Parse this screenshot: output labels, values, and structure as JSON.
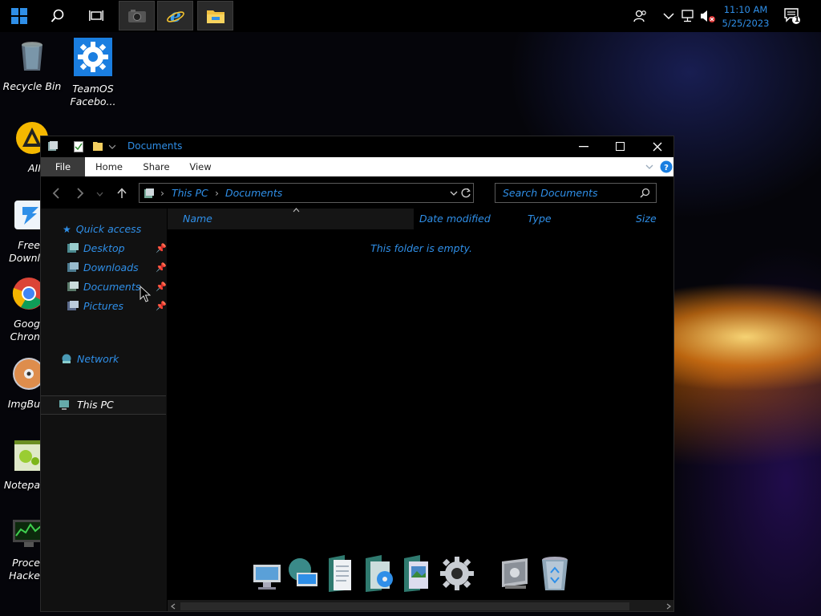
{
  "taskbar": {
    "clock_time": "11:10 AM",
    "clock_date": "5/25/2023",
    "notification_count": "1",
    "start_icon": "windows-logo-icon",
    "search_icon": "search-icon",
    "task_view_icon": "task-view-icon",
    "pinned_apps": [
      "camera-app-icon",
      "internet-explorer-icon",
      "file-explorer-icon"
    ],
    "tray_icons": [
      "people-icon",
      "chevron-up-icon",
      "network-icon",
      "volume-muted-icon",
      "action-center-icon"
    ]
  },
  "desktop": {
    "icons": [
      {
        "label": "Recycle Bin",
        "icon": "recycle-bin-icon"
      },
      {
        "label": "TeamOS Facebo...",
        "icon": "gear-icon"
      },
      {
        "label": "AIM",
        "icon": "aimp-icon"
      },
      {
        "label": "Free Downl",
        "icon": "free-download-manager-icon"
      },
      {
        "label": "Goog Chron",
        "icon": "chrome-icon"
      },
      {
        "label": "ImgBu",
        "icon": "imgburn-icon"
      },
      {
        "label": "Notepa",
        "icon": "notepad-icon"
      },
      {
        "label": "Proce Hacke",
        "icon": "process-hacker-icon"
      }
    ]
  },
  "window": {
    "title": "Documents",
    "ribbon_tabs": [
      "File",
      "Home",
      "Share",
      "View"
    ],
    "address": {
      "crumbs": [
        "This PC",
        "Documents"
      ]
    },
    "search_placeholder": "Search Documents",
    "nav": {
      "quick_access": "Quick access",
      "quick_items": [
        "Desktop",
        "Downloads",
        "Documents",
        "Pictures"
      ],
      "this_pc": "This PC",
      "network": "Network"
    },
    "columns": [
      "Name",
      "Date modified",
      "Type",
      "Size"
    ],
    "empty_message": "This folder is empty."
  },
  "dock": {
    "items": [
      "computer-icon",
      "network-globe-icon",
      "documents-icon",
      "media-folder-icon",
      "pictures-folder-icon",
      "settings-gear-icon",
      "control-panel-icon",
      "recycle-bin-icon"
    ]
  },
  "colors": {
    "accent_blue": "#2f8fe8",
    "taskbar_bg": "#000000",
    "window_bg": "#000000",
    "navpane_bg": "#111111"
  }
}
